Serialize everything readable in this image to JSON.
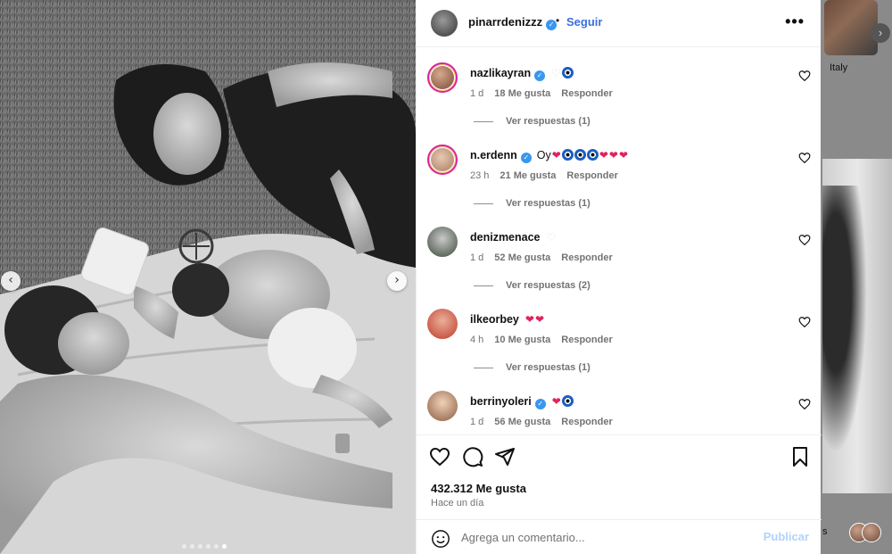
{
  "background": {
    "thumb_caption": "Italy",
    "bottom_text": "s"
  },
  "post": {
    "username": "pinarrdenizzz",
    "separator": "•",
    "follow_label": "Seguir",
    "more_label": "•••"
  },
  "carousel": {
    "prev_label": "‹",
    "next_label": "›",
    "dot_count": 6,
    "active_dot": 5
  },
  "comments": [
    {
      "username": "nazlikayran",
      "verified": true,
      "text": "",
      "emoji": [
        "white-heart",
        "evil-eye"
      ],
      "age": "1 d",
      "likes": "18 Me gusta",
      "reply_label": "Responder",
      "replies": "Ver respuestas (1)",
      "story_ring": true
    },
    {
      "username": "n.erdenn",
      "verified": true,
      "text": "Oy",
      "emoji": [
        "red-heart",
        "evil-eye",
        "evil-eye",
        "evil-eye",
        "red-heart",
        "red-heart",
        "red-heart"
      ],
      "age": "23 h",
      "likes": "21 Me gusta",
      "reply_label": "Responder",
      "replies": "Ver respuestas (1)",
      "story_ring": true
    },
    {
      "username": "denizmenace",
      "verified": false,
      "text": "",
      "emoji": [
        "white-heart"
      ],
      "age": "1 d",
      "likes": "52 Me gusta",
      "reply_label": "Responder",
      "replies": "Ver respuestas (2)",
      "story_ring": false
    },
    {
      "username": "ilkeorbey",
      "verified": false,
      "text": "",
      "emoji": [
        "red-heart",
        "red-heart"
      ],
      "age": "4 h",
      "likes": "10 Me gusta",
      "reply_label": "Responder",
      "replies": "Ver respuestas (1)",
      "story_ring": false
    },
    {
      "username": "berrinyoleri",
      "verified": true,
      "text": "",
      "emoji": [
        "red-heart",
        "evil-eye"
      ],
      "age": "1 d",
      "likes": "56 Me gusta",
      "reply_label": "Responder",
      "replies": "",
      "story_ring": false
    }
  ],
  "actions": {
    "likes": "432.312 Me gusta",
    "time": "Hace un día"
  },
  "add_comment": {
    "placeholder": "Agrega un comentario...",
    "post_label": "Publicar"
  },
  "colors": {
    "link": "#3a6fe0",
    "verified": "#3897f0",
    "post_disabled": "#b2d2fb",
    "heart_red": "#e0245e"
  }
}
